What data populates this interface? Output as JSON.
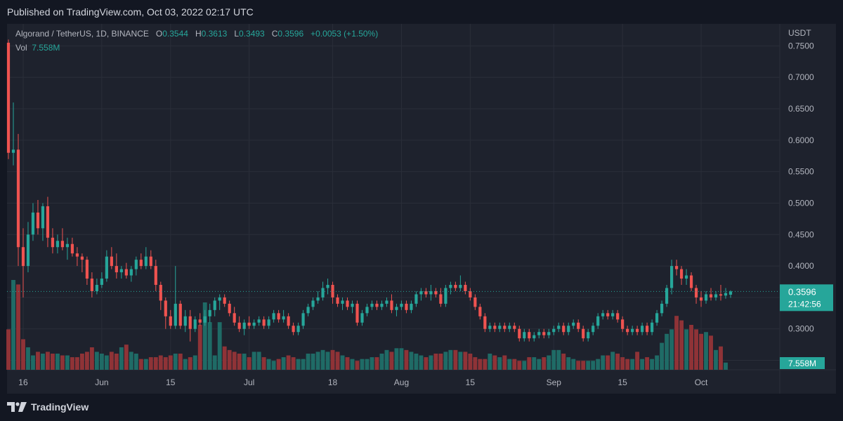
{
  "header": {
    "published": "Published on TradingView.com, Oct 03, 2022 02:17 UTC"
  },
  "legend": {
    "symbol": "Algorand / TetherUS, 1D, BINANCE",
    "o_label": "O",
    "o": "0.3544",
    "h_label": "H",
    "h": "0.3613",
    "l_label": "L",
    "l": "0.3493",
    "c_label": "C",
    "c": "0.3596",
    "change": "+0.0053 (+1.50%)",
    "vol_label": "Vol",
    "vol": "7.558M"
  },
  "footer": {
    "brand": "TradingView"
  },
  "colors": {
    "up": "#26a69a",
    "down": "#ef5350",
    "up_vol": "#1f6b66",
    "down_vol": "#8f3337",
    "grid": "#2a2e39",
    "bg": "#1e222d"
  },
  "chart_data": {
    "type": "candlestick",
    "title": "Algorand / TetherUS, 1D, BINANCE",
    "y_axis_label": "USDT",
    "y_ticks": [
      "0.7500",
      "0.7000",
      "0.6500",
      "0.6000",
      "0.5500",
      "0.5000",
      "0.4500",
      "0.4000",
      "0.3500",
      "0.3000",
      "0.2500"
    ],
    "y_tick_values": [
      0.75,
      0.7,
      0.65,
      0.6,
      0.55,
      0.5,
      0.45,
      0.4,
      0.35,
      0.3,
      0.25
    ],
    "ylim": [
      0.235,
      0.785
    ],
    "x_ticks": [
      {
        "label": "16",
        "day": 3
      },
      {
        "label": "Jun",
        "day": 19
      },
      {
        "label": "15",
        "day": 33
      },
      {
        "label": "Jul",
        "day": 49
      },
      {
        "label": "18",
        "day": 66
      },
      {
        "label": "Aug",
        "day": 80
      },
      {
        "label": "15",
        "day": 94
      },
      {
        "label": "Sep",
        "day": 111
      },
      {
        "label": "15",
        "day": 125
      },
      {
        "label": "Oct",
        "day": 141
      }
    ],
    "last_price": "0.3596",
    "last_price_value": 0.3596,
    "countdown": "21:42:56",
    "last_volume": "7.558M",
    "candles": [
      [
        0.755,
        0.76,
        0.57,
        0.58
      ],
      [
        0.58,
        0.66,
        0.56,
        0.585
      ],
      [
        0.585,
        0.61,
        0.4,
        0.43
      ],
      [
        0.43,
        0.46,
        0.35,
        0.4
      ],
      [
        0.4,
        0.47,
        0.39,
        0.45
      ],
      [
        0.45,
        0.5,
        0.44,
        0.485
      ],
      [
        0.485,
        0.505,
        0.45,
        0.46
      ],
      [
        0.46,
        0.5,
        0.44,
        0.495
      ],
      [
        0.495,
        0.51,
        0.43,
        0.445
      ],
      [
        0.445,
        0.46,
        0.42,
        0.43
      ],
      [
        0.43,
        0.45,
        0.42,
        0.44
      ],
      [
        0.44,
        0.46,
        0.425,
        0.43
      ],
      [
        0.43,
        0.445,
        0.41,
        0.435
      ],
      [
        0.435,
        0.445,
        0.415,
        0.42
      ],
      [
        0.42,
        0.43,
        0.4,
        0.415
      ],
      [
        0.415,
        0.42,
        0.39,
        0.41
      ],
      [
        0.41,
        0.415,
        0.37,
        0.38
      ],
      [
        0.38,
        0.39,
        0.35,
        0.36
      ],
      [
        0.36,
        0.38,
        0.355,
        0.37
      ],
      [
        0.37,
        0.39,
        0.365,
        0.38
      ],
      [
        0.38,
        0.425,
        0.375,
        0.415
      ],
      [
        0.415,
        0.43,
        0.395,
        0.4
      ],
      [
        0.4,
        0.42,
        0.38,
        0.39
      ],
      [
        0.39,
        0.4,
        0.38,
        0.395
      ],
      [
        0.395,
        0.405,
        0.38,
        0.385
      ],
      [
        0.385,
        0.4,
        0.375,
        0.395
      ],
      [
        0.395,
        0.415,
        0.385,
        0.41
      ],
      [
        0.41,
        0.42,
        0.395,
        0.4
      ],
      [
        0.4,
        0.43,
        0.395,
        0.415
      ],
      [
        0.415,
        0.425,
        0.395,
        0.4
      ],
      [
        0.4,
        0.41,
        0.36,
        0.37
      ],
      [
        0.37,
        0.375,
        0.33,
        0.345
      ],
      [
        0.345,
        0.35,
        0.3,
        0.32
      ],
      [
        0.32,
        0.33,
        0.3,
        0.305
      ],
      [
        0.305,
        0.4,
        0.3,
        0.34
      ],
      [
        0.34,
        0.345,
        0.3,
        0.305
      ],
      [
        0.305,
        0.33,
        0.295,
        0.32
      ],
      [
        0.32,
        0.33,
        0.28,
        0.3
      ],
      [
        0.3,
        0.32,
        0.295,
        0.315
      ],
      [
        0.315,
        0.325,
        0.305,
        0.31
      ],
      [
        0.31,
        0.33,
        0.305,
        0.32
      ],
      [
        0.32,
        0.34,
        0.31,
        0.33
      ],
      [
        0.33,
        0.35,
        0.32,
        0.345
      ],
      [
        0.345,
        0.355,
        0.33,
        0.35
      ],
      [
        0.35,
        0.355,
        0.335,
        0.34
      ],
      [
        0.34,
        0.345,
        0.32,
        0.325
      ],
      [
        0.325,
        0.335,
        0.305,
        0.31
      ],
      [
        0.31,
        0.32,
        0.295,
        0.3
      ],
      [
        0.3,
        0.315,
        0.29,
        0.31
      ],
      [
        0.31,
        0.32,
        0.3,
        0.305
      ],
      [
        0.305,
        0.315,
        0.3,
        0.31
      ],
      [
        0.31,
        0.32,
        0.305,
        0.315
      ],
      [
        0.315,
        0.32,
        0.3,
        0.305
      ],
      [
        0.305,
        0.32,
        0.3,
        0.315
      ],
      [
        0.315,
        0.33,
        0.31,
        0.325
      ],
      [
        0.325,
        0.33,
        0.31,
        0.315
      ],
      [
        0.315,
        0.33,
        0.31,
        0.32
      ],
      [
        0.32,
        0.325,
        0.3,
        0.305
      ],
      [
        0.305,
        0.31,
        0.29,
        0.295
      ],
      [
        0.295,
        0.31,
        0.29,
        0.305
      ],
      [
        0.305,
        0.33,
        0.3,
        0.325
      ],
      [
        0.325,
        0.34,
        0.32,
        0.335
      ],
      [
        0.335,
        0.35,
        0.33,
        0.345
      ],
      [
        0.345,
        0.36,
        0.34,
        0.35
      ],
      [
        0.35,
        0.375,
        0.345,
        0.365
      ],
      [
        0.365,
        0.38,
        0.355,
        0.37
      ],
      [
        0.37,
        0.375,
        0.34,
        0.35
      ],
      [
        0.35,
        0.355,
        0.335,
        0.34
      ],
      [
        0.34,
        0.35,
        0.33,
        0.345
      ],
      [
        0.345,
        0.35,
        0.33,
        0.335
      ],
      [
        0.335,
        0.345,
        0.325,
        0.34
      ],
      [
        0.34,
        0.345,
        0.305,
        0.31
      ],
      [
        0.31,
        0.33,
        0.305,
        0.325
      ],
      [
        0.325,
        0.34,
        0.32,
        0.335
      ],
      [
        0.335,
        0.345,
        0.33,
        0.34
      ],
      [
        0.34,
        0.345,
        0.33,
        0.335
      ],
      [
        0.335,
        0.345,
        0.33,
        0.34
      ],
      [
        0.34,
        0.35,
        0.335,
        0.345
      ],
      [
        0.345,
        0.355,
        0.325,
        0.33
      ],
      [
        0.33,
        0.34,
        0.32,
        0.335
      ],
      [
        0.335,
        0.345,
        0.33,
        0.34
      ],
      [
        0.34,
        0.345,
        0.325,
        0.33
      ],
      [
        0.33,
        0.345,
        0.325,
        0.34
      ],
      [
        0.34,
        0.36,
        0.335,
        0.355
      ],
      [
        0.355,
        0.365,
        0.345,
        0.36
      ],
      [
        0.36,
        0.365,
        0.35,
        0.355
      ],
      [
        0.355,
        0.37,
        0.345,
        0.36
      ],
      [
        0.36,
        0.365,
        0.35,
        0.355
      ],
      [
        0.355,
        0.365,
        0.335,
        0.34
      ],
      [
        0.34,
        0.37,
        0.335,
        0.365
      ],
      [
        0.365,
        0.375,
        0.355,
        0.37
      ],
      [
        0.37,
        0.375,
        0.36,
        0.365
      ],
      [
        0.365,
        0.385,
        0.36,
        0.37
      ],
      [
        0.37,
        0.375,
        0.355,
        0.36
      ],
      [
        0.36,
        0.365,
        0.345,
        0.35
      ],
      [
        0.35,
        0.355,
        0.33,
        0.335
      ],
      [
        0.335,
        0.34,
        0.315,
        0.32
      ],
      [
        0.32,
        0.325,
        0.295,
        0.3
      ],
      [
        0.3,
        0.31,
        0.295,
        0.305
      ],
      [
        0.305,
        0.31,
        0.295,
        0.3
      ],
      [
        0.3,
        0.31,
        0.295,
        0.305
      ],
      [
        0.305,
        0.31,
        0.295,
        0.3
      ],
      [
        0.3,
        0.31,
        0.295,
        0.305
      ],
      [
        0.305,
        0.31,
        0.295,
        0.3
      ],
      [
        0.3,
        0.305,
        0.28,
        0.285
      ],
      [
        0.285,
        0.3,
        0.28,
        0.295
      ],
      [
        0.295,
        0.3,
        0.28,
        0.285
      ],
      [
        0.285,
        0.295,
        0.28,
        0.29
      ],
      [
        0.29,
        0.3,
        0.285,
        0.295
      ],
      [
        0.295,
        0.3,
        0.285,
        0.29
      ],
      [
        0.29,
        0.3,
        0.285,
        0.295
      ],
      [
        0.295,
        0.305,
        0.29,
        0.3
      ],
      [
        0.3,
        0.31,
        0.295,
        0.305
      ],
      [
        0.305,
        0.31,
        0.29,
        0.295
      ],
      [
        0.295,
        0.31,
        0.29,
        0.305
      ],
      [
        0.305,
        0.315,
        0.3,
        0.31
      ],
      [
        0.31,
        0.315,
        0.295,
        0.3
      ],
      [
        0.3,
        0.305,
        0.28,
        0.285
      ],
      [
        0.285,
        0.3,
        0.28,
        0.295
      ],
      [
        0.295,
        0.31,
        0.29,
        0.305
      ],
      [
        0.305,
        0.325,
        0.3,
        0.32
      ],
      [
        0.32,
        0.33,
        0.315,
        0.325
      ],
      [
        0.325,
        0.33,
        0.315,
        0.32
      ],
      [
        0.32,
        0.33,
        0.315,
        0.325
      ],
      [
        0.325,
        0.33,
        0.31,
        0.315
      ],
      [
        0.315,
        0.32,
        0.295,
        0.3
      ],
      [
        0.3,
        0.305,
        0.29,
        0.295
      ],
      [
        0.295,
        0.305,
        0.29,
        0.3
      ],
      [
        0.3,
        0.305,
        0.29,
        0.295
      ],
      [
        0.295,
        0.31,
        0.29,
        0.305
      ],
      [
        0.305,
        0.31,
        0.29,
        0.295
      ],
      [
        0.295,
        0.315,
        0.29,
        0.31
      ],
      [
        0.31,
        0.33,
        0.305,
        0.325
      ],
      [
        0.325,
        0.345,
        0.32,
        0.34
      ],
      [
        0.34,
        0.37,
        0.335,
        0.365
      ],
      [
        0.365,
        0.41,
        0.355,
        0.4
      ],
      [
        0.4,
        0.41,
        0.385,
        0.395
      ],
      [
        0.395,
        0.4,
        0.37,
        0.38
      ],
      [
        0.38,
        0.395,
        0.37,
        0.385
      ],
      [
        0.385,
        0.39,
        0.36,
        0.365
      ],
      [
        0.365,
        0.37,
        0.34,
        0.35
      ],
      [
        0.35,
        0.36,
        0.335,
        0.345
      ],
      [
        0.345,
        0.36,
        0.34,
        0.355
      ],
      [
        0.355,
        0.365,
        0.345,
        0.35
      ],
      [
        0.35,
        0.36,
        0.345,
        0.355
      ],
      [
        0.355,
        0.37,
        0.345,
        0.353
      ],
      [
        0.353,
        0.365,
        0.348,
        0.357
      ],
      [
        0.3544,
        0.3613,
        0.3493,
        0.3596
      ]
    ],
    "volumes": [
      0.45,
      1.0,
      0.95,
      0.34,
      0.25,
      0.16,
      0.2,
      0.18,
      0.2,
      0.18,
      0.18,
      0.16,
      0.16,
      0.14,
      0.14,
      0.18,
      0.2,
      0.25,
      0.2,
      0.18,
      0.16,
      0.2,
      0.18,
      0.25,
      0.28,
      0.2,
      0.18,
      0.12,
      0.12,
      0.14,
      0.14,
      0.16,
      0.14,
      0.16,
      0.18,
      0.18,
      0.12,
      0.14,
      0.16,
      0.5,
      0.75,
      0.53,
      0.16,
      0.53,
      0.26,
      0.22,
      0.2,
      0.18,
      0.18,
      0.14,
      0.2,
      0.2,
      0.14,
      0.12,
      0.1,
      0.12,
      0.14,
      0.16,
      0.14,
      0.12,
      0.12,
      0.18,
      0.18,
      0.2,
      0.22,
      0.2,
      0.22,
      0.2,
      0.16,
      0.14,
      0.12,
      0.1,
      0.12,
      0.12,
      0.14,
      0.14,
      0.18,
      0.22,
      0.2,
      0.24,
      0.24,
      0.22,
      0.2,
      0.18,
      0.16,
      0.14,
      0.16,
      0.18,
      0.18,
      0.2,
      0.22,
      0.22,
      0.2,
      0.2,
      0.18,
      0.14,
      0.12,
      0.12,
      0.18,
      0.16,
      0.14,
      0.16,
      0.12,
      0.12,
      0.1,
      0.1,
      0.14,
      0.14,
      0.12,
      0.14,
      0.16,
      0.22,
      0.22,
      0.18,
      0.14,
      0.12,
      0.1,
      0.1,
      0.1,
      0.1,
      0.12,
      0.16,
      0.16,
      0.2,
      0.18,
      0.14,
      0.12,
      0.12,
      0.2,
      0.12,
      0.14,
      0.12,
      0.16,
      0.3,
      0.4,
      0.45,
      0.6,
      0.55,
      0.45,
      0.5,
      0.45,
      0.4,
      0.42,
      0.38,
      0.22,
      0.26,
      0.08
    ]
  }
}
